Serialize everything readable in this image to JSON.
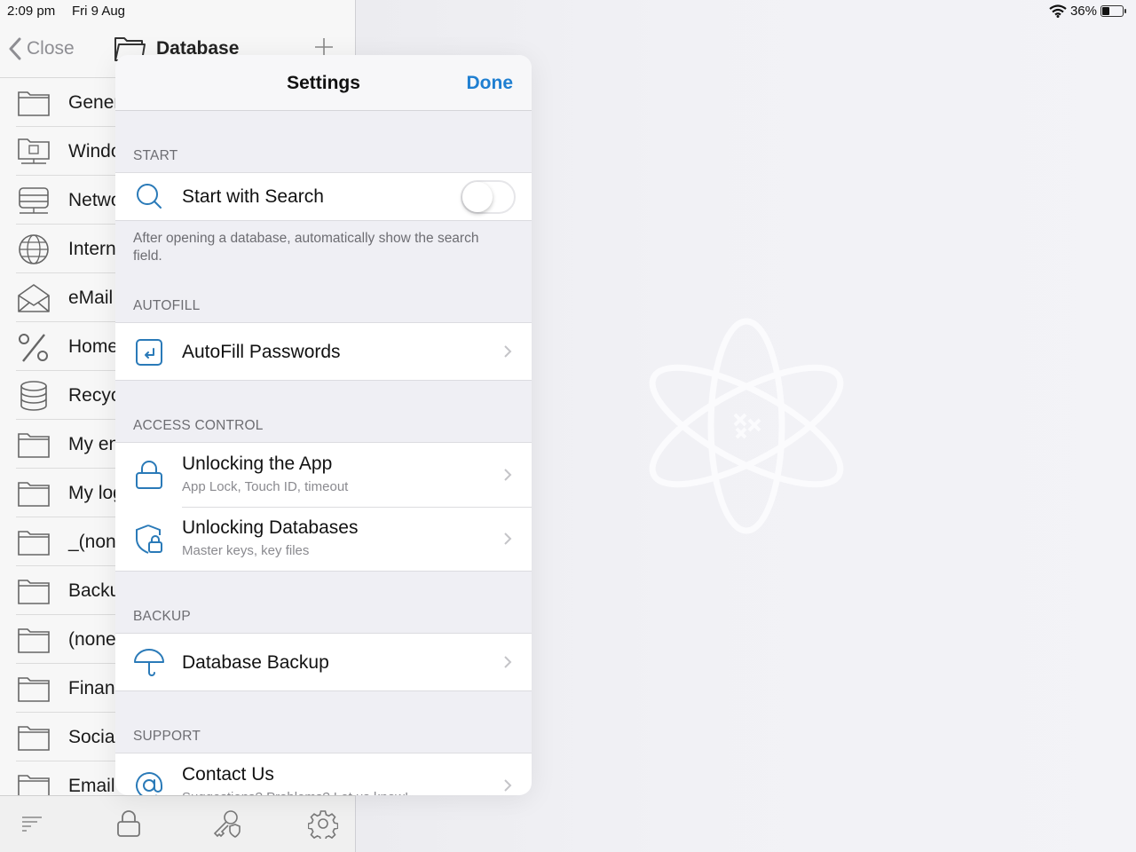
{
  "status_bar": {
    "time": "2:09 pm",
    "date": "Fri 9 Aug",
    "battery_text": "36%",
    "battery_level": 0.36
  },
  "master": {
    "close_label": "Close",
    "title": "Database",
    "groups": [
      {
        "label": "General",
        "icon": "folder-icon"
      },
      {
        "label": "Windows",
        "icon": "windows-folder-icon"
      },
      {
        "label": "Network",
        "icon": "network-server-icon"
      },
      {
        "label": "Internet",
        "icon": "globe-icon"
      },
      {
        "label": "eMail",
        "icon": "envelope-open-icon"
      },
      {
        "label": "Homebanking",
        "icon": "percent-icon"
      },
      {
        "label": "Recycle Bin",
        "icon": "database-icon"
      },
      {
        "label": "My entries",
        "icon": "folder-icon"
      },
      {
        "label": "My logins",
        "icon": "folder-icon"
      },
      {
        "label": "_(none)",
        "icon": "folder-icon"
      },
      {
        "label": "Backup",
        "icon": "folder-icon"
      },
      {
        "label": "(none)",
        "icon": "folder-icon"
      },
      {
        "label": "Finance",
        "icon": "folder-icon"
      },
      {
        "label": "Social",
        "icon": "folder-icon"
      },
      {
        "label": "Email",
        "icon": "folder-icon"
      }
    ],
    "toolbar": [
      "sort-icon",
      "lock-icon",
      "key-shield-icon",
      "gear-icon"
    ]
  },
  "settings": {
    "title": "Settings",
    "done_label": "Done",
    "accent_color": "#1f7fd1",
    "sections": {
      "start": {
        "header": "START",
        "row_title": "Start with Search",
        "toggle_on": false,
        "footer": "After opening a database, automatically show the search field."
      },
      "autofill": {
        "header": "AUTOFILL",
        "row_title": "AutoFill Passwords"
      },
      "access_control": {
        "header": "ACCESS CONTROL",
        "rows": [
          {
            "title": "Unlocking the App",
            "subtitle": "App Lock, Touch ID, timeout"
          },
          {
            "title": "Unlocking Databases",
            "subtitle": "Master keys, key files"
          }
        ]
      },
      "backup": {
        "header": "BACKUP",
        "row_title": "Database Backup"
      },
      "support": {
        "header": "SUPPORT",
        "row_title": "Contact Us",
        "row_subtitle": "Suggestions? Problems? Let us know!"
      }
    }
  }
}
